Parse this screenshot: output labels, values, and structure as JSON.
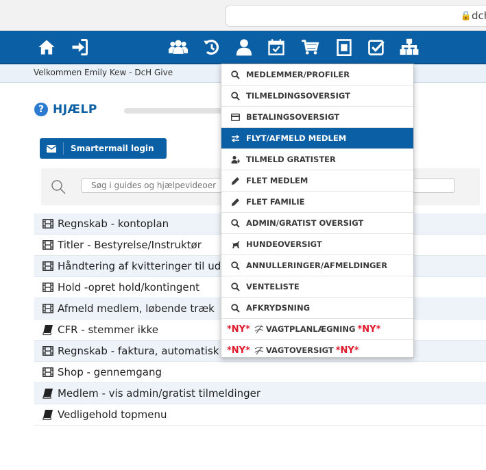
{
  "browser": {
    "url": "dch-"
  },
  "nav": {
    "icons": [
      "home-icon",
      "sign-in-icon",
      "users-icon",
      "history-icon",
      "user-icon",
      "calendar-check-icon",
      "cart-icon",
      "clipboard-icon",
      "checkbox-icon",
      "sitemap-icon"
    ]
  },
  "welcome": "Velkommen Emily Kew - DcH Give",
  "help": {
    "title": "HJÆLP",
    "smartermail_label": "Smartermail login",
    "search_placeholder": "Søg i guides og hjælpevideoer"
  },
  "guides": [
    {
      "label": "Regnskab - kontoplan",
      "icon": "film-icon"
    },
    {
      "label": "Titler - Bestyrelse/Instruktør",
      "icon": "film-icon"
    },
    {
      "label": "Håndtering af kvitteringer til udlæg",
      "icon": "film-icon"
    },
    {
      "label": "Hold -opret hold/kontingent",
      "icon": "film-icon"
    },
    {
      "label": "Afmeld medlem, løbende træk",
      "icon": "film-icon"
    },
    {
      "label": "CFR - stemmer ikke",
      "icon": "book-icon"
    },
    {
      "label": "Regnskab - faktura, automatisk træk",
      "icon": "film-icon"
    },
    {
      "label": "Shop - gennemgang",
      "icon": "film-icon"
    },
    {
      "label": "Medlem - vis admin/gratist tilmeldinger",
      "icon": "book-icon"
    },
    {
      "label": "Vedligehold topmenu",
      "icon": "book-icon"
    }
  ],
  "dropdown": {
    "ny_tag": "*NY*",
    "items": [
      {
        "label": "MEDLEMMER/PROFILER",
        "icon": "search-icon"
      },
      {
        "label": "TILMELDINGSOVERSIGT",
        "icon": "search-icon"
      },
      {
        "label": "BETALINGSOVERSIGT",
        "icon": "credit-card-icon"
      },
      {
        "label": "FLYT/AFMELD MEDLEM",
        "icon": "exchange-icon",
        "active": true
      },
      {
        "label": "TILMELD GRATISTER",
        "icon": "user-plus-icon"
      },
      {
        "label": "FLET MEDLEM",
        "icon": "pencil-icon"
      },
      {
        "label": "FLET FAMILIE",
        "icon": "pencil-icon"
      },
      {
        "label": "ADMIN/GRATIST OVERSIGT",
        "icon": "search-icon"
      },
      {
        "label": "HUNDEOVERSIGT",
        "icon": "dog-icon"
      },
      {
        "label": "ANNULLERINGER/AFMELDINGER",
        "icon": "search-icon"
      },
      {
        "label": "VENTELISTE",
        "icon": "search-icon"
      },
      {
        "label": "AFKRYDSNING",
        "icon": "search-icon"
      },
      {
        "label": "VAGTPLANLÆGNING",
        "icon": "swirl-icon",
        "ny": true
      },
      {
        "label": "VAGTOVERSIGT",
        "icon": "swirl-icon",
        "ny": true
      }
    ]
  },
  "colors": {
    "nav_blue": "#0b5fa5",
    "ny_red": "#e0192b",
    "row_shade": "#edf3f9"
  }
}
